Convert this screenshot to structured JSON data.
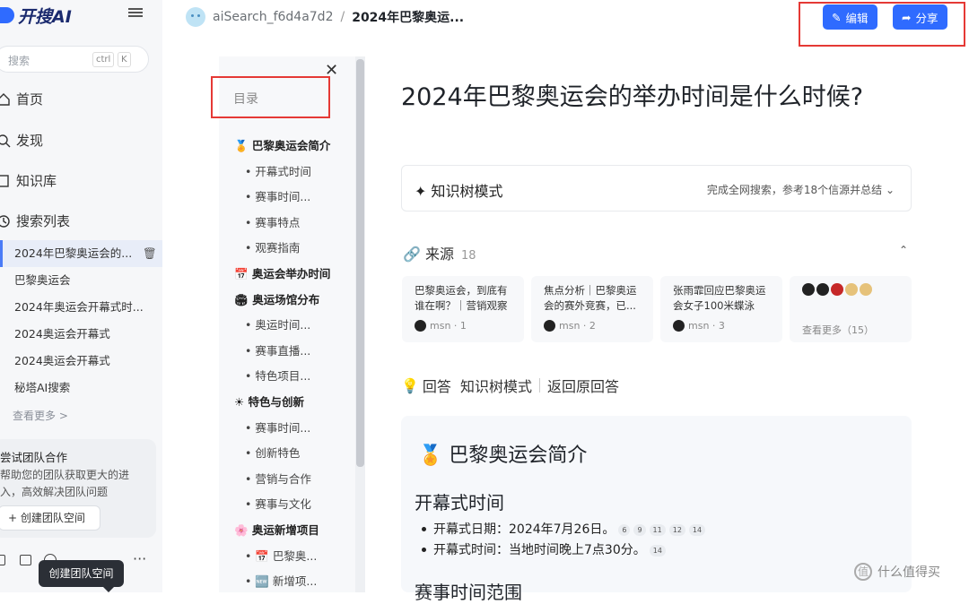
{
  "app": {
    "logo_text": "开搜AI"
  },
  "sidebar": {
    "search_placeholder": "搜索",
    "kbd1": "ctrl",
    "kbd2": "K",
    "nav": [
      {
        "label": "首页",
        "icon": "home-icon"
      },
      {
        "label": "发现",
        "icon": "search-icon"
      },
      {
        "label": "知识库",
        "icon": "book-icon"
      },
      {
        "label": "搜索列表",
        "icon": "history-icon"
      }
    ],
    "history": [
      "2024年巴黎奥运会的...",
      "巴黎奥运会",
      "2024年奥运会开幕式时...",
      "2024奥运会开幕式",
      "2024奥运会开幕式",
      "秘塔AI搜索"
    ],
    "more": "查看更多 >",
    "team_title": "尝试团队合作",
    "team_desc": "帮助您的团队获取更大的进",
    "team_desc2": "入，高效解决团队问题",
    "team_button": "+ 创建团队空间",
    "tooltip": "创建团队空间"
  },
  "topbar": {
    "user": "aiSearch_f6d4a7d2",
    "page": "2024年巴黎奥运...",
    "edit": "编辑",
    "share": "分享"
  },
  "toc": {
    "title": "目录",
    "items": [
      {
        "t": "🏅 巴黎奥运会简介",
        "k": "h"
      },
      {
        "t": "• 开幕式时间",
        "k": "s"
      },
      {
        "t": "• 赛事时间...",
        "k": "s"
      },
      {
        "t": "• 赛事特点",
        "k": "s"
      },
      {
        "t": "• 观赛指南",
        "k": "s"
      },
      {
        "t": "📅 奥运会举办时间",
        "k": "h"
      },
      {
        "t": "🏟 奥运场馆分布",
        "k": "h"
      },
      {
        "t": "• 奥运时间...",
        "k": "s"
      },
      {
        "t": "• 赛事直播...",
        "k": "s"
      },
      {
        "t": "• 特色项目...",
        "k": "s"
      },
      {
        "t": "☀ 特色与创新",
        "k": "h"
      },
      {
        "t": "• 赛事时间...",
        "k": "s"
      },
      {
        "t": "• 创新特色",
        "k": "s"
      },
      {
        "t": "• 营销与合作",
        "k": "s"
      },
      {
        "t": "• 赛事与文化",
        "k": "s"
      },
      {
        "t": "🌸 奥运新增项目",
        "k": "h"
      },
      {
        "t": "• 📅 巴黎奥...",
        "k": "s"
      },
      {
        "t": "• 🆕 新增项...",
        "k": "s"
      }
    ]
  },
  "main": {
    "title": "2024年巴黎奥运会的举办时间是什么时候?",
    "mode": "✦ 知识树模式",
    "mode_status": "完成全网搜索，参考18个信源并总结",
    "sources_label": "来源",
    "sources_count": "18",
    "cards": [
      {
        "t": "巴黎奥运会，到底有谁在啊？｜营销观察",
        "m": "msn · 1"
      },
      {
        "t": "焦点分析｜巴黎奥运会的赛外竞赛，已...",
        "m": "msn · 2"
      },
      {
        "t": "张雨霏回应巴黎奥运会女子100米蝶泳摘...",
        "m": "msn · 3"
      },
      {
        "t": "",
        "m": "查看更多（15）"
      }
    ],
    "answer": "回答",
    "answer_mode": "知识树模式",
    "answer_back": "返回原回答",
    "section": "巴黎奥运会简介",
    "sub1": "开幕式时间",
    "li1": "开幕式日期：2024年7月26日。",
    "li1c": [
      "6",
      "9",
      "11",
      "12",
      "14"
    ],
    "li2": "开幕式时间：当地时间晚上7点30分。",
    "li2c": [
      "14"
    ],
    "sub2": "赛事时间范围"
  },
  "watermark": "什么值得买"
}
